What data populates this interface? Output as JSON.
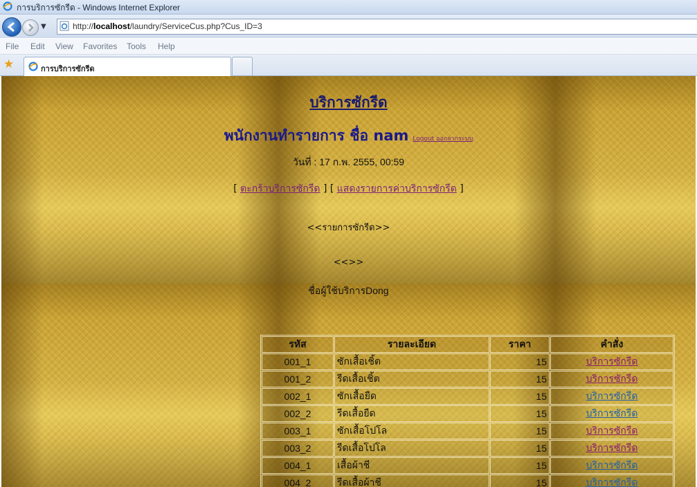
{
  "window": {
    "title": "การบริการซักรีด - Windows Internet Explorer",
    "url_prefix": "http://",
    "url_host": "localhost",
    "url_path": "/laundry/ServiceCus.php?Cus_ID=3"
  },
  "menu": [
    "File",
    "Edit",
    "View",
    "Favorites",
    "Tools",
    "Help"
  ],
  "tab": {
    "label": "การบริการซักรีด"
  },
  "page": {
    "title": "บริการซักรีด",
    "staff_label": "พนักงานทำรายการ ชื่อ nam",
    "logout": "Logout ออกจากระบบ",
    "date": "วันที่ : 17 ก.พ. 2555, 00:59",
    "link_open": "[ ",
    "link_basket": "ตะกร้าบริการซักรีด",
    "link_mid": " ] [ ",
    "link_list": "แสดงรายการค่าบริการซักรีด",
    "link_close": " ]",
    "list_header": "<<รายการซักรีด>>",
    "empty_marker": "<<>>",
    "user_label": "ชื่อผู้ใช้บริการDong"
  },
  "table": {
    "headers": [
      "รหัส",
      "รายละเอียด",
      "ราคา",
      "คำสั่ง"
    ],
    "rows": [
      {
        "id": "001_1",
        "desc": "ซักเสื้อเชิ้ต",
        "price": "15",
        "action": "บริการซักรีด",
        "visited": true
      },
      {
        "id": "001_2",
        "desc": "รีดเสื้อเชิ้ต",
        "price": "15",
        "action": "บริการซักรีด",
        "visited": true
      },
      {
        "id": "002_1",
        "desc": "ซักเสื้อยืด",
        "price": "15",
        "action": "บริการซักรีด",
        "visited": false
      },
      {
        "id": "002_2",
        "desc": "รีดเสื้อยืด",
        "price": "15",
        "action": "บริการซักรีด",
        "visited": false
      },
      {
        "id": "003_1",
        "desc": "ซักเสื้อโปโล",
        "price": "15",
        "action": "บริการซักรีด",
        "visited": true
      },
      {
        "id": "003_2",
        "desc": "รีดเสื้อโปโล",
        "price": "15",
        "action": "บริการซักรีด",
        "visited": true
      },
      {
        "id": "004_1",
        "desc": "เสื้อผ้าชี",
        "price": "15",
        "action": "บริการซักรีด",
        "visited": false
      },
      {
        "id": "004_2",
        "desc": "รีดเสื้อผ้าชี",
        "price": "15",
        "action": "บริการซักรีด",
        "visited": false
      }
    ]
  },
  "colors": {
    "link_visited": "#8a1a6e",
    "link_unvisited": "#1f5fa8"
  }
}
